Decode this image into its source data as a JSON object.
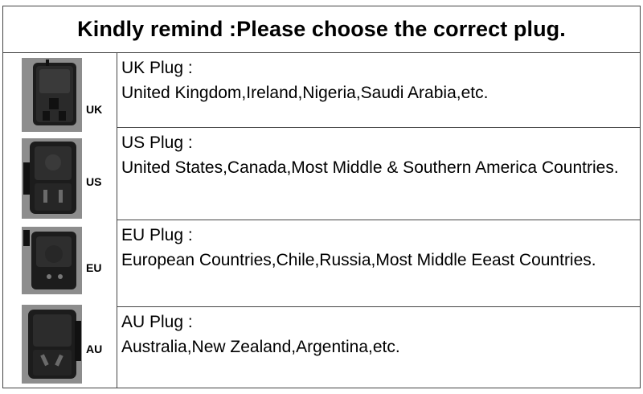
{
  "header": {
    "title": "Kindly remind :Please choose the correct plug."
  },
  "plugs": [
    {
      "code": "UK",
      "title": "UK Plug :",
      "desc": "United Kingdom,Ireland,Nigeria,Saudi Arabia,etc."
    },
    {
      "code": "US",
      "title": "US Plug :",
      "desc": "United States,Canada,Most Middle & Southern America Countries."
    },
    {
      "code": "EU",
      "title": "EU Plug :",
      "desc": "European Countries,Chile,Russia,Most Middle Eeast Countries."
    },
    {
      "code": "AU",
      "title": "AU Plug :",
      "desc": "Australia,New Zealand,Argentina,etc."
    }
  ]
}
